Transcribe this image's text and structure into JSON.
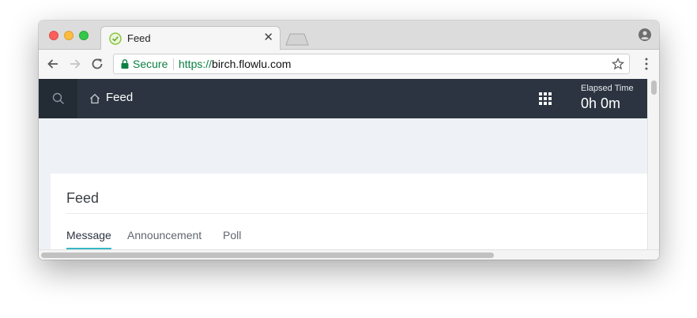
{
  "browser": {
    "tab": {
      "title": "Feed",
      "close_glyph": "✕",
      "favicon": "check-shield-icon"
    },
    "url": {
      "secure_label": "Secure",
      "scheme": "https://",
      "host": "birch.flowlu.com"
    }
  },
  "app": {
    "header": {
      "title": "Feed",
      "elapsed_label": "Elapsed Time",
      "elapsed_value": "0h 0m"
    },
    "colors": {
      "header_bg": "#2b3440",
      "accent": "#35b7c7",
      "secure_green": "#0b8043"
    }
  },
  "feed": {
    "title": "Feed",
    "tabs": [
      {
        "label": "Message",
        "active": true
      },
      {
        "label": "Announcement",
        "active": false
      },
      {
        "label": "Poll",
        "active": false
      }
    ]
  }
}
